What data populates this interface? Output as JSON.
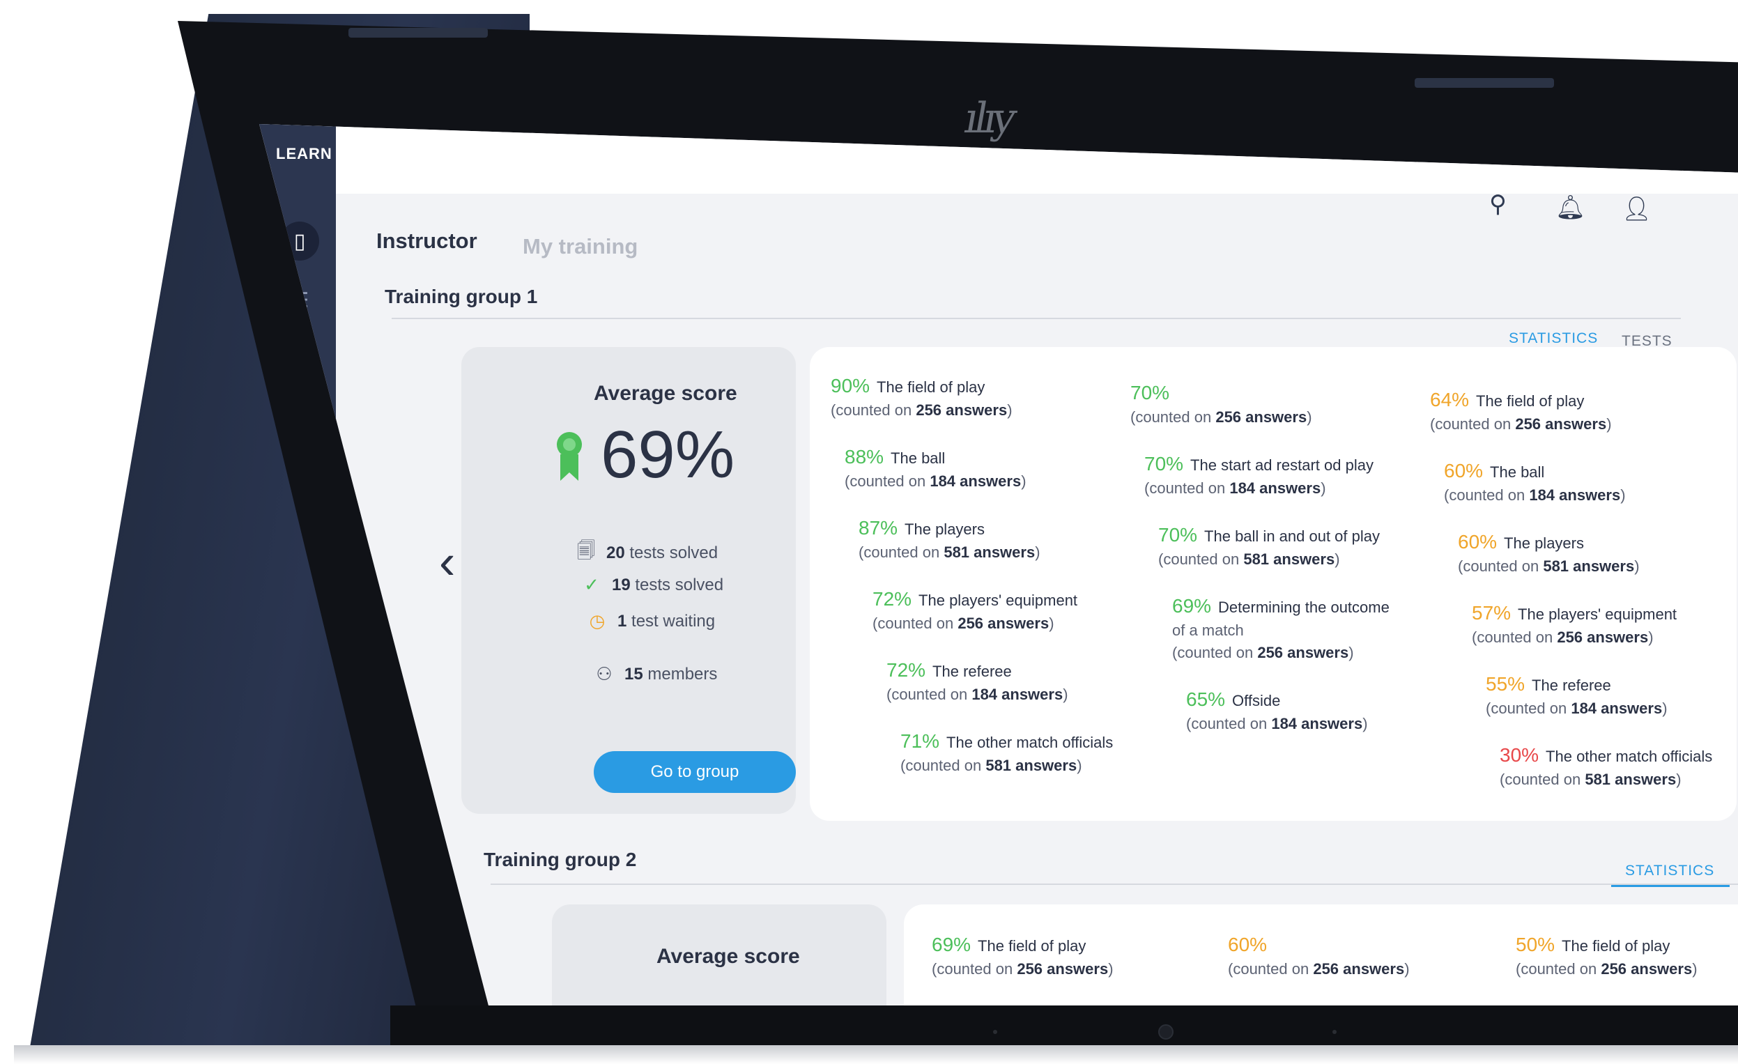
{
  "app": {
    "brand": "LEARN"
  },
  "tabs": {
    "instructor": "Instructor",
    "my_training": "My training"
  },
  "group1": {
    "title": "Training group 1",
    "tabs": {
      "statistics": "STATISTICS",
      "tests": "TESTS"
    },
    "score": {
      "title": "Average score",
      "value": "69%",
      "tests_solved_count": "20",
      "tests_solved_label": "tests solved",
      "tests_solved2_count": "19",
      "tests_solved2_label": "tests solved",
      "waiting_count": "1",
      "waiting_label": "test waiting",
      "members_count": "15",
      "members_label": "members",
      "button": "Go to group"
    },
    "col1": [
      {
        "pct": "90%",
        "label": "The field of play",
        "answers": "256 answers"
      },
      {
        "pct": "88%",
        "label": "The ball",
        "answers": "184 answers"
      },
      {
        "pct": "87%",
        "label": "The players",
        "answers": "581 answers"
      },
      {
        "pct": "72%",
        "label": "The players' equipment",
        "answers": "256 answers"
      },
      {
        "pct": "72%",
        "label": "The referee",
        "answers": "184 answers"
      },
      {
        "pct": "71%",
        "label": "The other match officials",
        "answers": "581 answers"
      }
    ],
    "col2": [
      {
        "pct": "70%",
        "label": "",
        "answers": "256 answers"
      },
      {
        "pct": "70%",
        "label": "The start ad restart od play",
        "answers": "184 answers"
      },
      {
        "pct": "70%",
        "label": "The ball in and out of play",
        "answers": "581 answers"
      },
      {
        "pct": "69%",
        "label": "Determining the outcome",
        "label2": "of a match",
        "answers": "256 answers"
      },
      {
        "pct": "65%",
        "label": "Offside",
        "answers": "184 answers"
      }
    ],
    "col3": [
      {
        "pct": "64%",
        "label": "The field of play",
        "answers": "256 answers"
      },
      {
        "pct": "60%",
        "label": "The ball",
        "answers": "184 answers"
      },
      {
        "pct": "60%",
        "label": "The players",
        "answers": "581 answers"
      },
      {
        "pct": "57%",
        "label": "The players' equipment",
        "answers": "256 answers"
      },
      {
        "pct": "55%",
        "label": "The referee",
        "answers": "184 answers"
      },
      {
        "pct": "30%",
        "label": "The other match officials",
        "answers": "581 answers"
      }
    ],
    "counted_prefix": "counted on"
  },
  "group2": {
    "title": "Training group 2",
    "tabs": {
      "statistics": "STATISTICS"
    },
    "score": {
      "title": "Average score"
    },
    "items": [
      {
        "pct": "69%",
        "label": "The field of play",
        "answers": "256 answers"
      },
      {
        "pct": "60%",
        "label": "",
        "answers": "256 answers"
      },
      {
        "pct": "50%",
        "label": "The field of play",
        "answers": "256 answers"
      }
    ]
  },
  "colors": {
    "accent": "#2a9be3",
    "good": "#4cbf5a",
    "medium": "#f0a52a",
    "bad": "#e8484a",
    "sidebar": "#2c3650"
  },
  "icons": [
    "notebook-icon",
    "list-icon",
    "users-icon",
    "calendar-icon",
    "bookmark-icon",
    "book-icon",
    "search-icon",
    "bell-icon",
    "user-icon",
    "award-icon",
    "document-icon",
    "check-circle-icon",
    "clock-icon",
    "members-icon",
    "chevron-left-icon",
    "chevron-right-icon"
  ]
}
